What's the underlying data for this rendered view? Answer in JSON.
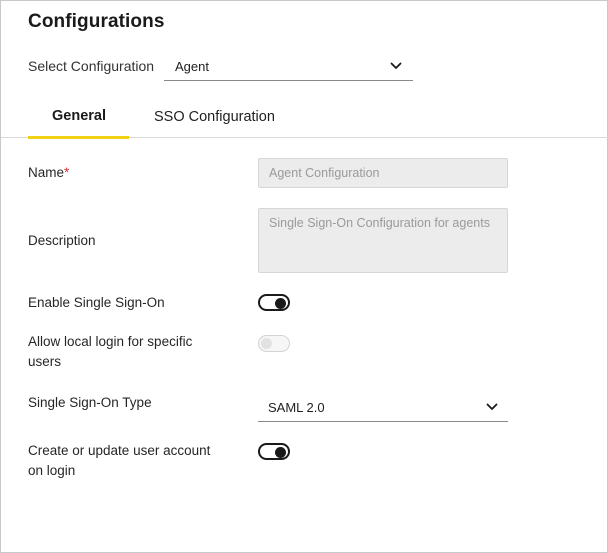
{
  "page": {
    "title": "Configurations"
  },
  "selector": {
    "label": "Select Configuration",
    "value": "Agent",
    "icon": "chevron-down-icon"
  },
  "tabs": [
    {
      "label": "General",
      "active": true
    },
    {
      "label": "SSO Configuration",
      "active": false
    }
  ],
  "form": {
    "name": {
      "label": "Name",
      "required_marker": "*",
      "placeholder": "Agent Configuration"
    },
    "description": {
      "label": "Description",
      "placeholder": "Single Sign-On Configuration for agents"
    },
    "enable_sso": {
      "label": "Enable Single Sign-On",
      "on": true
    },
    "allow_local_login": {
      "label_line1": "Allow local login for specific",
      "label_line2": "users",
      "on": false,
      "disabled": true
    },
    "sso_type": {
      "label": "Single Sign-On Type",
      "value": "SAML 2.0",
      "icon": "chevron-down-icon"
    },
    "create_update_account": {
      "label_line1": "Create or update user account",
      "label_line2": "on login",
      "on": true
    }
  },
  "colors": {
    "accent_tab_underline": "#f2d014",
    "required": "#d93025",
    "toggle_on": "#1a1a1a"
  }
}
